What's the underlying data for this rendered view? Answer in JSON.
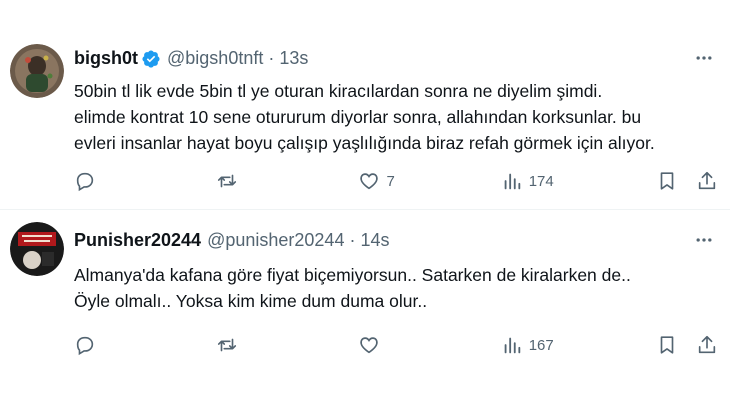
{
  "tweets": [
    {
      "name": "bigsh0t",
      "verified": true,
      "handle": "@bigsh0tnft",
      "separator": "·",
      "time": "13s",
      "text": "50bin tl lik evde 5bin tl ye oturan kiracılardan sonra ne diyelim şimdi.\nelimde kontrat 10 sene otururum diyorlar sonra, allahından korksunlar. bu\nevleri insanlar hayat boyu çalışıp yaşlılığında biraz refah görmek için alıyor.",
      "likes": "7",
      "views": "174"
    },
    {
      "name": "Punisher20244",
      "verified": false,
      "handle": "@punisher20244",
      "separator": "·",
      "time": "14s",
      "text": "Almanya'da kafana göre fiyat biçemiyorsun.. Satarken de kiralarken de..\nÖyle olmalı.. Yoksa kim kime dum duma olur..",
      "likes": "",
      "views": "167"
    }
  ],
  "colors": {
    "text": "#0f1419",
    "secondary": "#536471",
    "verified": "#1d9bf0",
    "divider": "#eff3f4"
  },
  "icons": [
    "reply-icon",
    "retweet-icon",
    "like-icon",
    "views-icon",
    "bookmark-icon",
    "share-icon",
    "more-icon",
    "verified-badge-icon"
  ]
}
